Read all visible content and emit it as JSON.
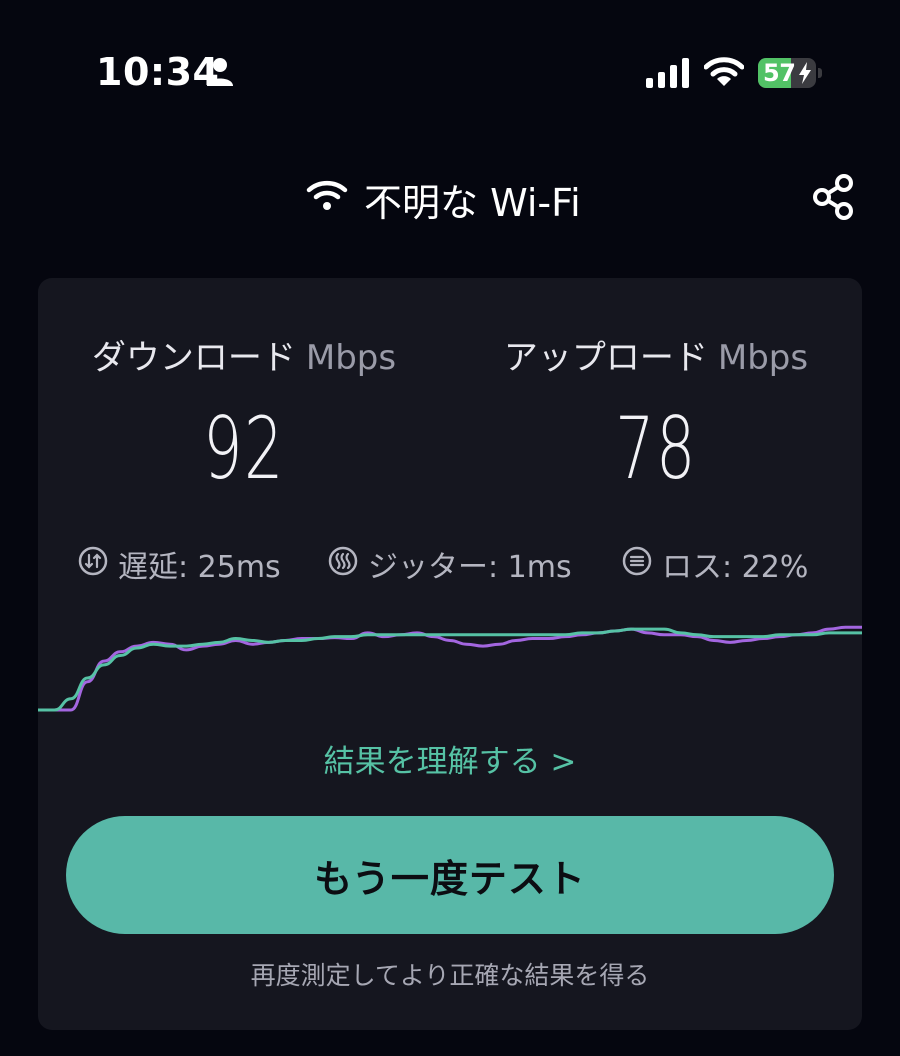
{
  "status_bar": {
    "time": "10:34",
    "battery_level": 57,
    "battery_text": "57",
    "icons": [
      "person-icon",
      "cellular-signal-icon",
      "wifi-icon",
      "battery-charging-icon"
    ]
  },
  "header": {
    "network_name": "不明な Wi-Fi",
    "icons": [
      "wifi-icon",
      "share-icon"
    ]
  },
  "results": {
    "download": {
      "label": "ダウンロード",
      "unit": "Mbps",
      "value": "92"
    },
    "upload": {
      "label": "アップロード",
      "unit": "Mbps",
      "value": "78"
    },
    "latency": {
      "text": "遅延: 25ms",
      "icon": "latency-icon"
    },
    "jitter": {
      "text": "ジッター: 1ms",
      "icon": "jitter-icon"
    },
    "loss": {
      "text": "ロス: 22%",
      "icon": "loss-icon"
    }
  },
  "chart_data": {
    "type": "line",
    "x": [
      0,
      2,
      4,
      6,
      8,
      10,
      12,
      14,
      16,
      18,
      20,
      22,
      24,
      26,
      28,
      30,
      32,
      34,
      36,
      38,
      40,
      42,
      44,
      46,
      48,
      50,
      52,
      54,
      56,
      58,
      60,
      62,
      64,
      66,
      68,
      70,
      72,
      74,
      76,
      78,
      80,
      82,
      84,
      86,
      88,
      90,
      92,
      94,
      96,
      98,
      100
    ],
    "series": [
      {
        "color": "#a366e0",
        "values": [
          0,
          0,
          0,
          30,
          52,
          62,
          68,
          72,
          70,
          64,
          68,
          70,
          74,
          70,
          72,
          74,
          76,
          76,
          77,
          76,
          82,
          78,
          80,
          82,
          78,
          74,
          70,
          68,
          70,
          74,
          76,
          76,
          78,
          80,
          82,
          84,
          86,
          82,
          80,
          80,
          78,
          74,
          72,
          74,
          76,
          78,
          80,
          82,
          86,
          88,
          88
        ]
      },
      {
        "color": "#56c2a5",
        "values": [
          0,
          0,
          12,
          34,
          48,
          58,
          66,
          70,
          68,
          68,
          70,
          72,
          76,
          74,
          72,
          74,
          74,
          76,
          78,
          78,
          80,
          80,
          80,
          80,
          80,
          80,
          80,
          80,
          80,
          80,
          80,
          80,
          80,
          82,
          82,
          84,
          86,
          86,
          86,
          82,
          80,
          78,
          78,
          78,
          78,
          80,
          80,
          80,
          82,
          82,
          82
        ]
      }
    ],
    "ylim": [
      0,
      100
    ]
  },
  "links": {
    "understand_results": "結果を理解する >"
  },
  "actions": {
    "retest_label": "もう一度テスト",
    "hint": "再度測定してより正確な結果を得る"
  },
  "colors": {
    "accent": "#58b8a8",
    "upload_line": "#a366e0",
    "download_line": "#56c2a5",
    "card_background": "#15161f"
  }
}
